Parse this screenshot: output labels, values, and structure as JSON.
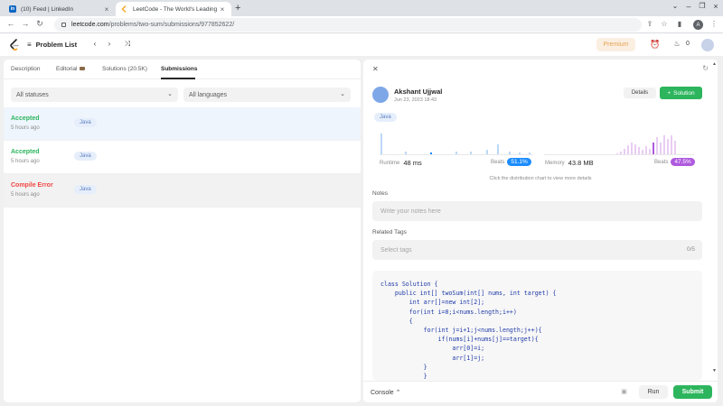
{
  "browser": {
    "tabs": [
      {
        "title": "(10) Feed | LinkedIn",
        "favicon": "linkedin-icon",
        "favicon_text": "in",
        "color": "#0a66c2"
      },
      {
        "title": "LeetCode - The World's Leading O",
        "favicon": "leetcode-icon",
        "color": "#f89f1b"
      }
    ],
    "url_host": "leetcode.com",
    "url_path": "/problems/two-sum/submissions/977852622/",
    "profile_initial": "A"
  },
  "header": {
    "problem_list": "Problem List",
    "premium": "Premium",
    "streak": "0"
  },
  "left_tabs": [
    {
      "label": "Description"
    },
    {
      "label": "Editorial"
    },
    {
      "label": "Solutions (20.5K)"
    },
    {
      "label": "Submissions",
      "active": true
    }
  ],
  "filters": {
    "status": "All statuses",
    "language": "All languages"
  },
  "submissions": [
    {
      "status": "Accepted",
      "time": "5 hours ago",
      "lang": "Java",
      "color": "#2db55d",
      "bg": "#eef5fc"
    },
    {
      "status": "Accepted",
      "time": "5 hours ago",
      "lang": "Java",
      "color": "#2db55d",
      "bg": "#ffffff"
    },
    {
      "status": "Compile Error",
      "time": "5 hours ago",
      "lang": "Java",
      "color": "#ef4743",
      "bg": "#f2f2f2"
    }
  ],
  "detail": {
    "user": "Akshant Ujjwal",
    "date": "Jun 23, 2023 18:43",
    "details_btn": "Details",
    "solution_btn": "Solution",
    "lang": "Java",
    "runtime_label": "Runtime",
    "runtime_value": "48 ms",
    "runtime_beats_label": "Beats",
    "runtime_beats": "51.1%",
    "memory_label": "Memory",
    "memory_value": "43.8 MB",
    "memory_beats_label": "Beats",
    "memory_beats": "47.5%",
    "hint": "Click the distribution chart to view more details",
    "notes_label": "Notes",
    "notes_placeholder": "Write your notes here",
    "tags_label": "Related Tags",
    "tags_placeholder": "Select tags",
    "tags_count": "0/5",
    "accent_blue": "#1c8cff",
    "accent_purple": "#ae5ade",
    "accent_green": "#2db55d"
  },
  "code_lines": [
    "class Solution {",
    "    public int[] twoSum(int[] nums, int target) {",
    "        int arr[]=new int[2];",
    "        for(int i=0;i<nums.length;i++)",
    "        {",
    "            for(int j=i+1;j<nums.length;j++){",
    "                if(nums[i]+nums[j]==target){",
    "                    arr[0]=i;",
    "                    arr[1]=j;",
    "            }",
    "            }"
  ],
  "footer": {
    "console": "Console",
    "run": "Run",
    "submit": "Submit"
  }
}
